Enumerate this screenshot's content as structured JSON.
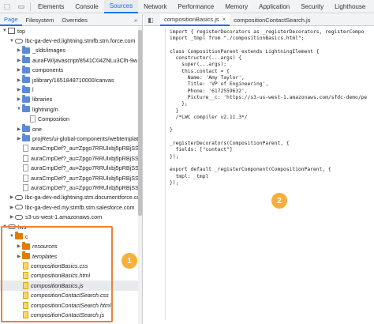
{
  "topbar": {
    "tabs": [
      "Elements",
      "Console",
      "Sources",
      "Network",
      "Performance",
      "Memory",
      "Application",
      "Security",
      "Lighthouse"
    ],
    "active_tab": "Sources"
  },
  "left_tabs": {
    "tabs": [
      "Page",
      "Filesystem",
      "Overrides"
    ],
    "more": "»",
    "active": "Page"
  },
  "tree": [
    {
      "label": "top",
      "indent": 0,
      "icon": "frame",
      "arrow": "▼"
    },
    {
      "label": "lbc-ga-dev-ed.lightning.stmfb.stm.force.com",
      "indent": 1,
      "icon": "cloud",
      "arrow": "▼"
    },
    {
      "label": "_slds/images",
      "indent": 2,
      "icon": "folder",
      "arrow": "▶"
    },
    {
      "label": "auraFW/javascript/8541C04ZNLu3Clh-9w",
      "indent": 2,
      "icon": "folder",
      "arrow": "▶"
    },
    {
      "label": "components",
      "indent": 2,
      "icon": "folder",
      "arrow": "▶"
    },
    {
      "label": "jslibrary/1651848710000/canvas",
      "indent": 2,
      "icon": "folder",
      "arrow": "▶"
    },
    {
      "label": "l",
      "indent": 2,
      "icon": "folder",
      "arrow": "▶"
    },
    {
      "label": "libraries",
      "indent": 2,
      "icon": "folder",
      "arrow": "▶"
    },
    {
      "label": "lightning/n",
      "indent": 2,
      "icon": "folder",
      "arrow": "▼"
    },
    {
      "label": "Composition",
      "indent": 3,
      "icon": "file",
      "arrow": ""
    },
    {
      "label": "one",
      "indent": 2,
      "icon": "folder",
      "arrow": "▶"
    },
    {
      "label": "projRes/ui-global-components/webtemplate",
      "indent": 2,
      "icon": "folder",
      "arrow": "▶"
    },
    {
      "label": "auraCmpDef?_au=Zpgo7RRUlxbj5pRBjSS",
      "indent": 2,
      "icon": "file",
      "arrow": ""
    },
    {
      "label": "auraCmpDef?_au=Zpgo7RRUlxbj5pRBjSS",
      "indent": 2,
      "icon": "file",
      "arrow": ""
    },
    {
      "label": "auraCmpDef?_au=Zpgo7RRUlxbj5pRBjSS",
      "indent": 2,
      "icon": "file",
      "arrow": ""
    },
    {
      "label": "auraCmpDef?_au=Zpgo7RRUlxbj5pRBjSS",
      "indent": 2,
      "icon": "file",
      "arrow": ""
    },
    {
      "label": "auraCmpDef?_au=Zpgo7RRUlxbj5pRBjSS",
      "indent": 2,
      "icon": "file",
      "arrow": ""
    },
    {
      "label": "lbc-ga-dev-ed.lightning.stm.documentforce.cc",
      "indent": 1,
      "icon": "cloud",
      "arrow": "▶"
    },
    {
      "label": "lbc-ga-dev-ed.my.stmfb.stm.salesforce.com",
      "indent": 1,
      "icon": "cloud",
      "arrow": "▶"
    },
    {
      "label": "s3-us-west-1.amazonaws.com",
      "indent": 1,
      "icon": "cloud",
      "arrow": "▶"
    },
    {
      "label": "lws",
      "indent": 0,
      "icon": "cloud",
      "arrow": "▼"
    },
    {
      "label": "c",
      "indent": 1,
      "icon": "folder-orange",
      "arrow": "▼"
    },
    {
      "label": "resources",
      "indent": 2,
      "icon": "folder-orange",
      "arrow": "▶",
      "italic": true
    },
    {
      "label": "templates",
      "indent": 2,
      "icon": "folder-orange",
      "arrow": "▶",
      "italic": true
    },
    {
      "label": "compositionBasics.css",
      "indent": 2,
      "icon": "file-yellow",
      "arrow": "",
      "italic": true
    },
    {
      "label": "compositionBasics.html",
      "indent": 2,
      "icon": "file-yellow",
      "arrow": "",
      "italic": true
    },
    {
      "label": "compositionBasics.js",
      "indent": 2,
      "icon": "file-yellow",
      "arrow": "",
      "italic": true,
      "selected": true
    },
    {
      "label": "compositionContactSearch.css",
      "indent": 2,
      "icon": "file-yellow",
      "arrow": "",
      "italic": true
    },
    {
      "label": "compositionContactSearch.html",
      "indent": 2,
      "icon": "file-yellow",
      "arrow": "",
      "italic": true
    },
    {
      "label": "compositionContactSearch.js",
      "indent": 2,
      "icon": "file-yellow",
      "arrow": "",
      "italic": true
    }
  ],
  "file_tabs": [
    {
      "label": "compositionBasics.js",
      "active": true,
      "close": "×"
    },
    {
      "label": "compositionContactSearch.js",
      "active": false
    }
  ],
  "code": [
    "import { registerDecorators as _registerDecorators, registerCompo",
    "import _tmpl from \"./compositionBasics.html\";",
    "",
    "class CompositionParent extends LightningElement {",
    "  constructor(...args) {",
    "    super(...args);",
    "    this.contact = {",
    "      Name: 'Amy Taylor',",
    "      Title: 'VP of Engineering',",
    "      Phone: '6172559632',",
    "      Picture__c: 'https://s3-us-west-1.amazonaws.com/sfdc-demo/pe",
    "    };",
    "  }",
    "  /*LWC compiler v2.11.3*/",
    "",
    "}",
    "",
    "_registerDecorators(CompositionParent, {",
    "  fields: [\"contact\"]",
    "});",
    "",
    "export default _registerComponent(CompositionParent, {",
    "  tmpl: _tmpl",
    "});"
  ],
  "badges": {
    "one": "1",
    "two": "2"
  },
  "colors": {
    "accent": "#1a73e8",
    "highlight_box": "#e8833a",
    "badge": "#f4b03a"
  }
}
